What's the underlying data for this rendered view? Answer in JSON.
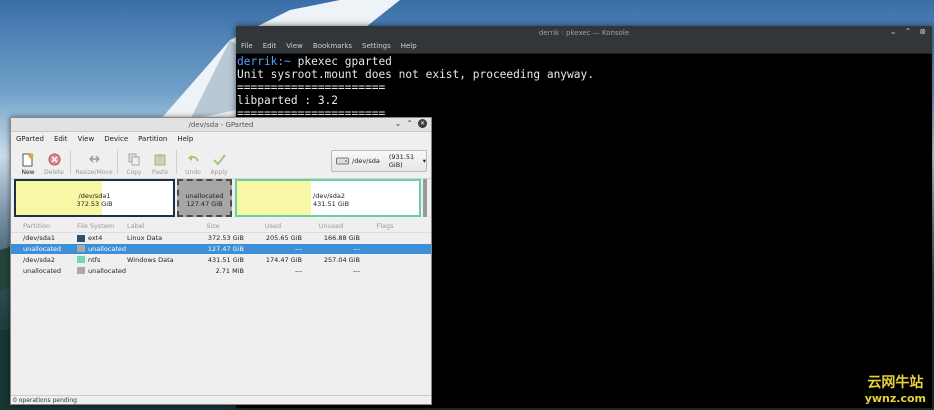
{
  "konsole": {
    "title": "derrik : pkexec — Konsole",
    "menu": [
      "File",
      "Edit",
      "View",
      "Bookmarks",
      "Settings",
      "Help"
    ],
    "prompt_user": "derrik:~",
    "lines": [
      " pkexec gparted",
      "Unit sysroot.mount does not exist, proceeding anyway.",
      "======================",
      "libparted : 3.2",
      "======================"
    ]
  },
  "gparted": {
    "title": "/dev/sda - GParted",
    "menu": [
      "GParted",
      "Edit",
      "View",
      "Device",
      "Partition",
      "Help"
    ],
    "toolbar": [
      {
        "label": "New",
        "icon": "new-icon",
        "enabled": true
      },
      {
        "label": "Delete",
        "icon": "delete-icon",
        "enabled": false
      },
      {
        "label": "Resize/Move",
        "icon": "resize-icon",
        "enabled": false
      },
      {
        "label": "Copy",
        "icon": "copy-icon",
        "enabled": false
      },
      {
        "label": "Paste",
        "icon": "paste-icon",
        "enabled": false
      },
      {
        "label": "Undo",
        "icon": "undo-icon",
        "enabled": false
      },
      {
        "label": "Apply",
        "icon": "apply-icon",
        "enabled": false
      }
    ],
    "device": {
      "name": "/dev/sda",
      "size": "(931.51 GiB)"
    },
    "disk_map": [
      {
        "name": "/dev/sda1",
        "size": "372.53 GiB"
      },
      {
        "name": "unallocated",
        "size": "127.47 GiB"
      },
      {
        "name": "/dev/sda2",
        "size": "431.51 GiB"
      }
    ],
    "columns": [
      "Partition",
      "File System",
      "Label",
      "Size",
      "Used",
      "Unused",
      "Flags"
    ],
    "rows": [
      {
        "partition": "/dev/sda1",
        "fs": "ext4",
        "fs_color": "#314e6c",
        "label": "Linux Data",
        "size": "372.53 GiB",
        "used": "205.65 GiB",
        "unused": "166.88 GiB",
        "flags": ""
      },
      {
        "partition": "unallocated",
        "fs": "unallocated",
        "fs_color": "#a9a9a9",
        "label": "",
        "size": "127.47 GiB",
        "used": "---",
        "unused": "---",
        "flags": "",
        "selected": true
      },
      {
        "partition": "/dev/sda2",
        "fs": "ntfs",
        "fs_color": "#6fd9b0",
        "label": "Windows Data",
        "size": "431.51 GiB",
        "used": "174.47 GiB",
        "unused": "257.04 GiB",
        "flags": ""
      },
      {
        "partition": "unallocated",
        "fs": "unallocated",
        "fs_color": "#a9a9a9",
        "label": "",
        "size": "2.71 MiB",
        "used": "---",
        "unused": "---",
        "flags": ""
      }
    ],
    "status": "0 operations pending"
  },
  "watermark": {
    "text": "云网牛站",
    "site": "ywnz.com"
  }
}
